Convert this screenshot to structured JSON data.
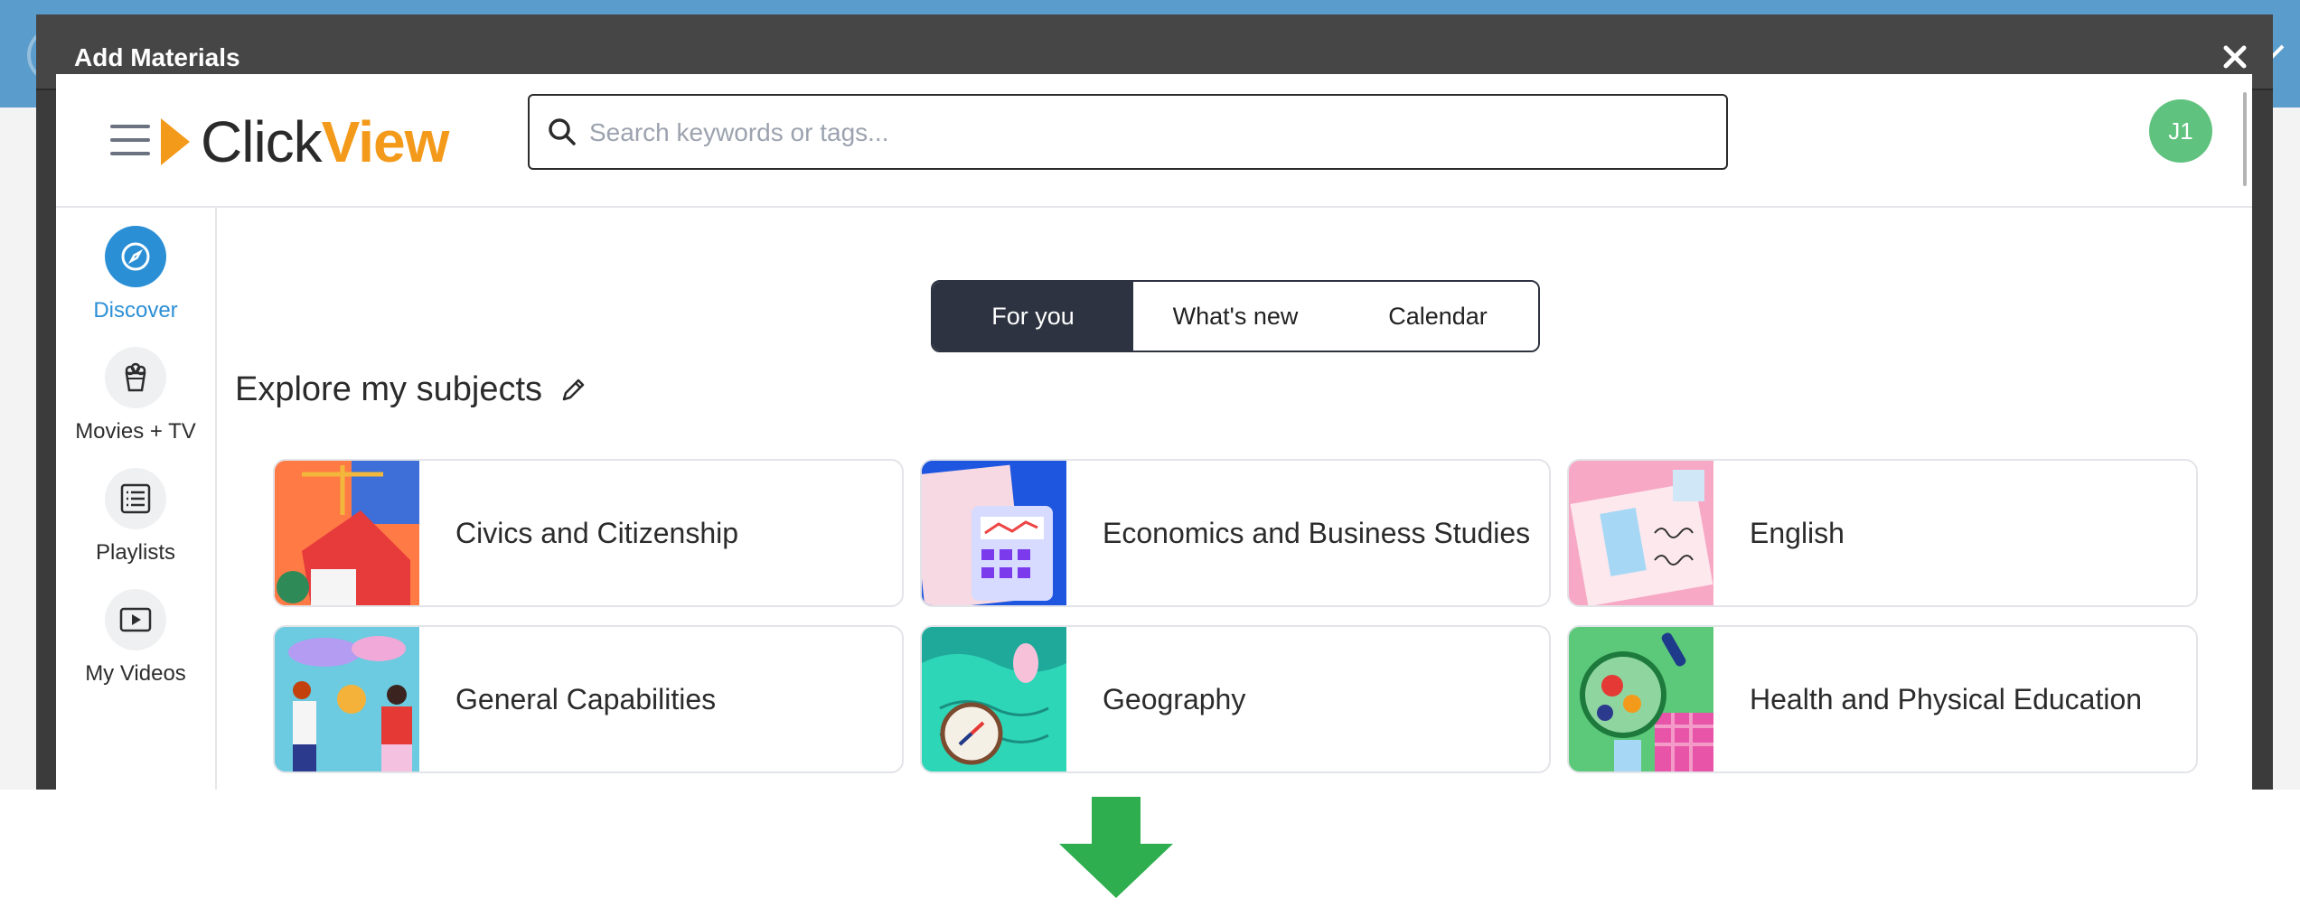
{
  "modal": {
    "title": "Add Materials"
  },
  "header": {
    "logo_click": "Click",
    "logo_view": "View",
    "search_placeholder": "Search keywords or tags...",
    "avatar_initials": "J1"
  },
  "sidebar": {
    "items": [
      {
        "label": "Discover",
        "icon": "compass-icon",
        "active": true
      },
      {
        "label": "Movies + TV",
        "icon": "popcorn-icon"
      },
      {
        "label": "Playlists",
        "icon": "playlist-icon"
      },
      {
        "label": "My Videos",
        "icon": "video-icon"
      }
    ]
  },
  "tabs": [
    {
      "label": "For you",
      "active": true
    },
    {
      "label": "What's new"
    },
    {
      "label": "Calendar"
    }
  ],
  "section": {
    "title": "Explore my subjects"
  },
  "subjects": [
    {
      "label": "Civics and Citizenship"
    },
    {
      "label": "Economics and Business Studies"
    },
    {
      "label": "English"
    },
    {
      "label": "General Capabilities"
    },
    {
      "label": "Geography"
    },
    {
      "label": "Health and Physical Education"
    }
  ],
  "colors": {
    "accent": "#2b8fd6",
    "brand_orange": "#f49a1a",
    "tab_active": "#2d3340",
    "avatar": "#5fc27e",
    "arrow": "#2eae4e"
  }
}
